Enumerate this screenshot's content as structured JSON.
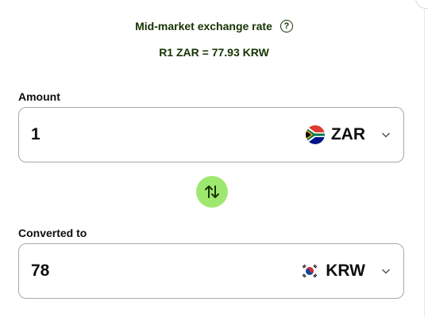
{
  "rate": {
    "title": "Mid-market exchange rate",
    "help_glyph": "?",
    "value": "R1 ZAR = 77.93 KRW"
  },
  "amount": {
    "label": "Amount",
    "value": "1",
    "currency": "ZAR",
    "flag_icon": "south-africa-flag-icon"
  },
  "swap": {
    "icon": "swap-vertical-arrows-icon",
    "color": "#9fe870"
  },
  "converted": {
    "label": "Converted to",
    "value": "78",
    "currency": "KRW",
    "flag_icon": "south-korea-flag-icon"
  },
  "colors": {
    "brand_green": "#163300",
    "accent_green": "#9fe870",
    "border": "#a7aba2"
  }
}
